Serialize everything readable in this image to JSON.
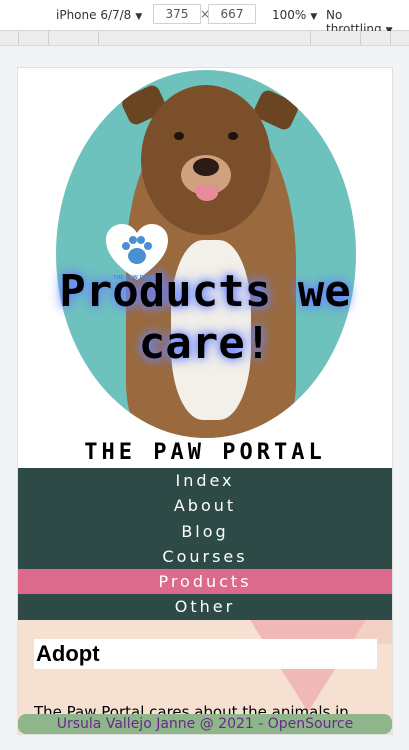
{
  "devtools": {
    "device": "iPhone 6/7/8",
    "width": "375",
    "times": "×",
    "height": "667",
    "zoom": "100%",
    "throttling": "No throttling"
  },
  "hero": {
    "title": "Products we care!",
    "logo_text": "THE PAW PORTAL"
  },
  "brand": "THE PAW PORTAL",
  "nav": {
    "items": [
      {
        "label": "Index"
      },
      {
        "label": "About"
      },
      {
        "label": "Blog"
      },
      {
        "label": "Courses"
      },
      {
        "label": "Products",
        "active": true
      },
      {
        "label": "Other"
      }
    ]
  },
  "content": {
    "heading": "Adopt",
    "text": "The Paw Portal cares about the animals in need, we try to help them at find a new home!"
  },
  "footer": "Ursula Vallejo Janne @ 2021 - OpenSource",
  "colors": {
    "nav_bg": "#2d4a47",
    "nav_active": "#dc6a8d",
    "footer_bg": "#8fb58a",
    "footer_text": "#6a2a8a",
    "oval_bg": "#6ec2bd"
  }
}
